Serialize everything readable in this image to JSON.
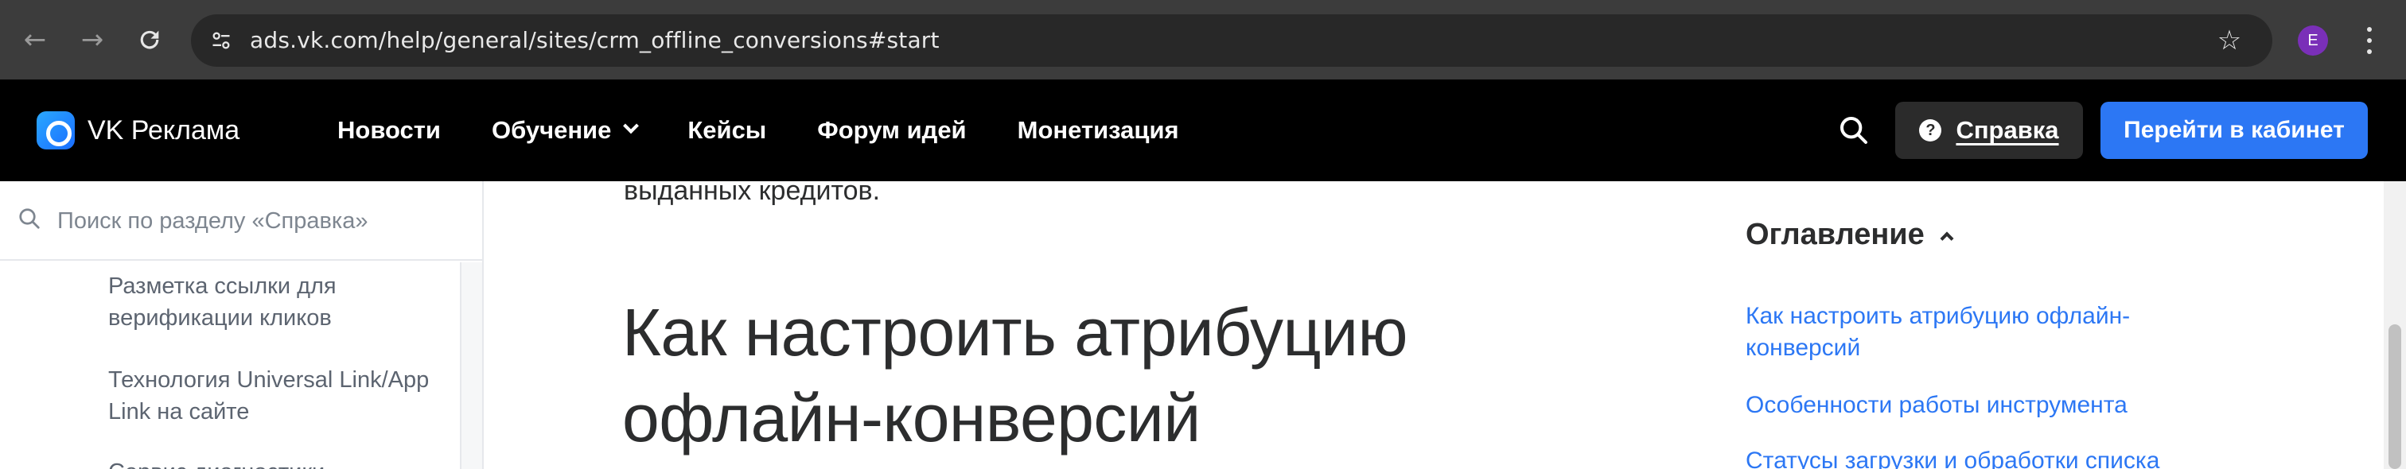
{
  "browser": {
    "url": "ads.vk.com/help/general/sites/crm_offline_conversions#start",
    "profile_initial": "E"
  },
  "header": {
    "logo_text": "VK Реклама",
    "nav": [
      {
        "label": "Новости"
      },
      {
        "label": "Обучение"
      },
      {
        "label": "Кейсы"
      },
      {
        "label": "Форум идей"
      },
      {
        "label": "Монетизация"
      }
    ],
    "help_label": "Справка",
    "cabinet_label": "Перейти в кабинет"
  },
  "sidebar": {
    "search_placeholder": "Поиск по разделу «Справка»",
    "items": [
      {
        "label": "Разметка ссылки для верификации кликов"
      },
      {
        "label": "Технология Universal Link/App Link на сайте"
      },
      {
        "label": "Сервис диагностики"
      }
    ]
  },
  "main": {
    "cut_text": "выданных кредитов.",
    "heading": "Как настроить атрибуцию офлайн-конверсий"
  },
  "toc": {
    "title": "Оглавление",
    "links": [
      {
        "label": "Как настроить атрибуцию офлайн-конверсий"
      },
      {
        "label": "Особенности работы инструмента"
      },
      {
        "label": "Статусы загрузки и обработки списка"
      }
    ]
  },
  "colors": {
    "accent": "#2c77f4",
    "header_bg": "#000000",
    "chrome_bg": "#3c3c3c"
  }
}
